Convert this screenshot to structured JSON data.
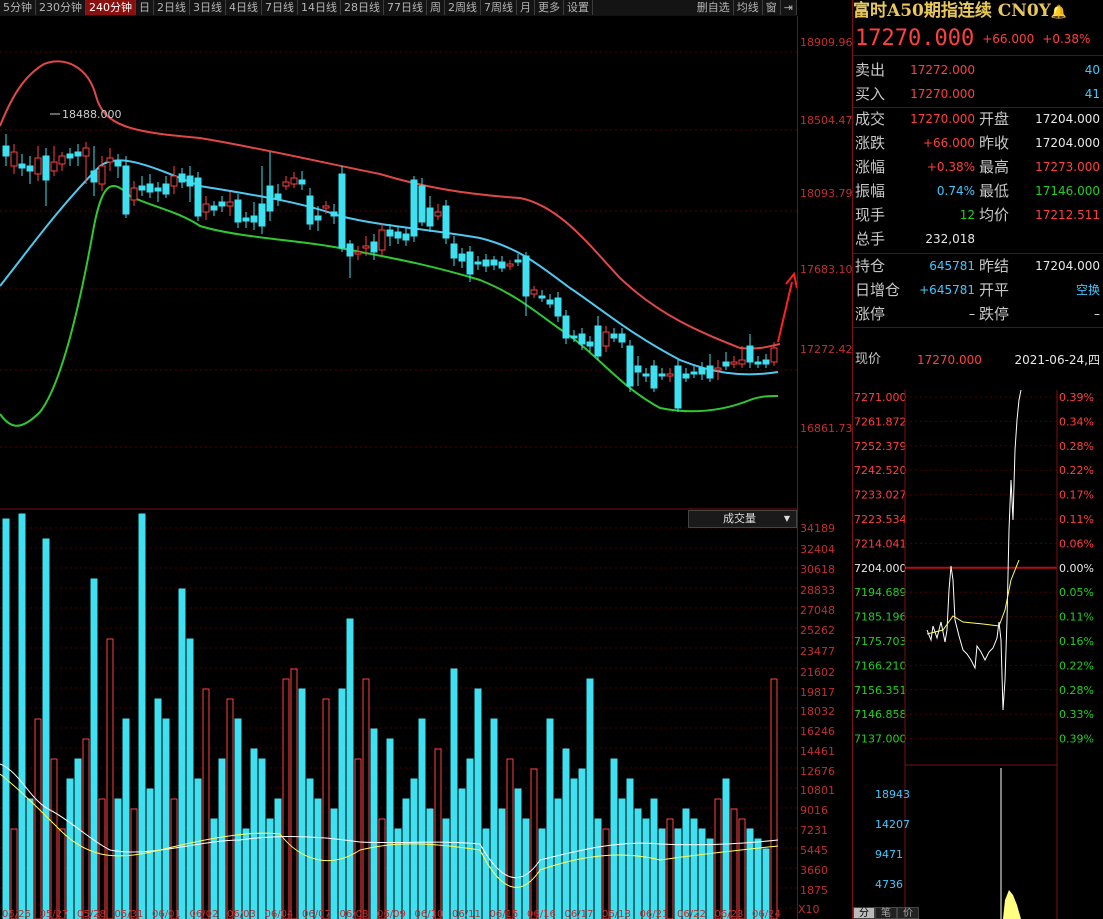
{
  "toolbar": {
    "periods": [
      "5分钟",
      "230分钟",
      "240分钟",
      "日",
      "2日线",
      "3日线",
      "4日线",
      "7日线",
      "14日线",
      "28日线",
      "77日线",
      "周",
      "2周线",
      "7周线",
      "月",
      "更多",
      "设置"
    ],
    "active_index": 2,
    "right_items": [
      "删自选",
      "均线",
      "窗"
    ],
    "exit_icon": "exit-icon"
  },
  "price_axis": [
    "18909.964",
    "18504.473",
    "18093.793",
    "17683.109",
    "17272.424",
    "16861.739"
  ],
  "high_marker": "18488.000",
  "volume": {
    "dropdown_label": "成交量",
    "axis": [
      "34189",
      "32404",
      "30618",
      "28833",
      "27048",
      "25262",
      "23477",
      "21602",
      "19817",
      "18032",
      "16246",
      "14461",
      "12676",
      "10801",
      "9016",
      "7231",
      "5445",
      "3660",
      "1875"
    ],
    "multiplier": "X10"
  },
  "date_axis": [
    "05/26",
    "05/27",
    "05/28",
    "05/31",
    "06/01",
    "06/02",
    "06/03",
    "06/04",
    "06/07",
    "06/08",
    "06/09",
    "06/10",
    "06/11",
    "06/15",
    "06/16",
    "06/17",
    "06/18",
    "06/21",
    "06/22",
    "06/23",
    "06/24"
  ],
  "quote": {
    "title": "富时A50期指连续 CN0Y",
    "price": "17270.000",
    "change": "+66.000",
    "change_pct": "+0.38%",
    "rows": [
      {
        "label": "卖出",
        "value": "17272.000",
        "value_color": "red",
        "extra": "40",
        "extra_color": "cyan"
      },
      {
        "label": "买入",
        "value": "17270.000",
        "value_color": "red",
        "extra": "41",
        "extra_color": "cyan"
      }
    ],
    "grid": [
      {
        "l1": "成交",
        "v1": "17270.000",
        "c1": "red",
        "l2": "开盘",
        "v2": "17204.000",
        "c2": "white"
      },
      {
        "l1": "涨跌",
        "v1": "+66.000",
        "c1": "red",
        "l2": "昨收",
        "v2": "17204.000",
        "c2": "white"
      },
      {
        "l1": "涨幅",
        "v1": "+0.38%",
        "c1": "red",
        "l2": "最高",
        "v2": "17273.000",
        "c2": "red"
      },
      {
        "l1": "振幅",
        "v1": "0.74%",
        "c1": "cyan",
        "l2": "最低",
        "v2": "17146.000",
        "c2": "green"
      },
      {
        "l1": "现手",
        "v1": "12",
        "c1": "green",
        "l2": "均价",
        "v2": "17212.511",
        "c2": "red"
      },
      {
        "l1": "总手",
        "v1": "232,018",
        "c1": "white",
        "l2": "",
        "v2": "",
        "c2": "white"
      }
    ],
    "grid2": [
      {
        "l1": "持仓",
        "v1": "645781",
        "c1": "cyan",
        "l2": "昨结",
        "v2": "17204.000",
        "c2": "white"
      },
      {
        "l1": "日增仓",
        "v1": "+645781",
        "c1": "cyan",
        "l2": "开平",
        "v2": "空换",
        "c2": "cyan"
      },
      {
        "l1": "涨停",
        "v1": "–",
        "c1": "white",
        "l2": "跌停",
        "v2": "–",
        "c2": "white"
      }
    ],
    "current_label": "现价",
    "current_value": "17270.000",
    "current_date": "2021-06-24,四"
  },
  "mini": {
    "left_axis": [
      "7271.000",
      "7261.872",
      "7252.379",
      "7242.520",
      "7233.027",
      "7223.534",
      "7214.041",
      "7204.000",
      "7194.689",
      "7185.196",
      "7175.703",
      "7166.210",
      "7156.351",
      "7146.858",
      "7137.000"
    ],
    "right_axis": [
      "0.39%",
      "0.34%",
      "0.28%",
      "0.22%",
      "0.17%",
      "0.11%",
      "0.06%",
      "0.00%",
      "0.05%",
      "0.11%",
      "0.16%",
      "0.22%",
      "0.28%",
      "0.33%",
      "0.39%"
    ],
    "vol_axis": [
      "18943",
      "14207",
      "9471",
      "4736"
    ],
    "tabs": [
      "分",
      "笔",
      "价"
    ]
  },
  "colors": {
    "up": "#ff4040",
    "down": "#40e0f0",
    "upper_band": "#e04848",
    "mid_band": "#50c8f0",
    "lower_band": "#30c830",
    "accent": "#8a0f0f"
  }
}
